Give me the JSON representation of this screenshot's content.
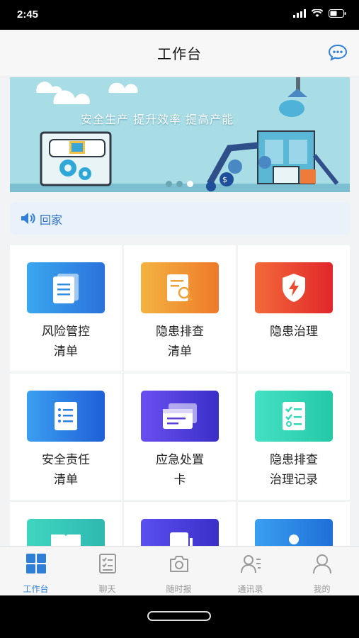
{
  "status": {
    "time": "2:45"
  },
  "header": {
    "title": "工作台"
  },
  "banner": {
    "slogan": "安全生产   提升效率   提高产能"
  },
  "notice": {
    "text": "回家"
  },
  "tiles": [
    {
      "line1": "风险管控",
      "line2": "清单",
      "icon": "document-stack-icon",
      "color": "#2f8de6"
    },
    {
      "line1": "隐患排查",
      "line2": "清单",
      "icon": "document-search-icon",
      "color": "#f0a23a"
    },
    {
      "line1": "隐患治理",
      "line2": "",
      "icon": "shield-bolt-icon",
      "color": "#f05a3a"
    },
    {
      "line1": "安全责任",
      "line2": "清单",
      "icon": "checklist-icon",
      "color": "#2d7fe6"
    },
    {
      "line1": "应急处置",
      "line2": "卡",
      "icon": "cards-icon",
      "color": "#5a3fd9"
    },
    {
      "line1": "隐患排查",
      "line2": "治理记录",
      "icon": "check-record-icon",
      "color": "#2fd9b9"
    }
  ],
  "tabs": [
    {
      "label": "工作台",
      "icon": "grid-icon"
    },
    {
      "label": "聊天",
      "icon": "chat-list-icon"
    },
    {
      "label": "随时报",
      "icon": "camera-icon"
    },
    {
      "label": "通讯录",
      "icon": "contacts-icon"
    },
    {
      "label": "我的",
      "icon": "person-icon"
    }
  ]
}
